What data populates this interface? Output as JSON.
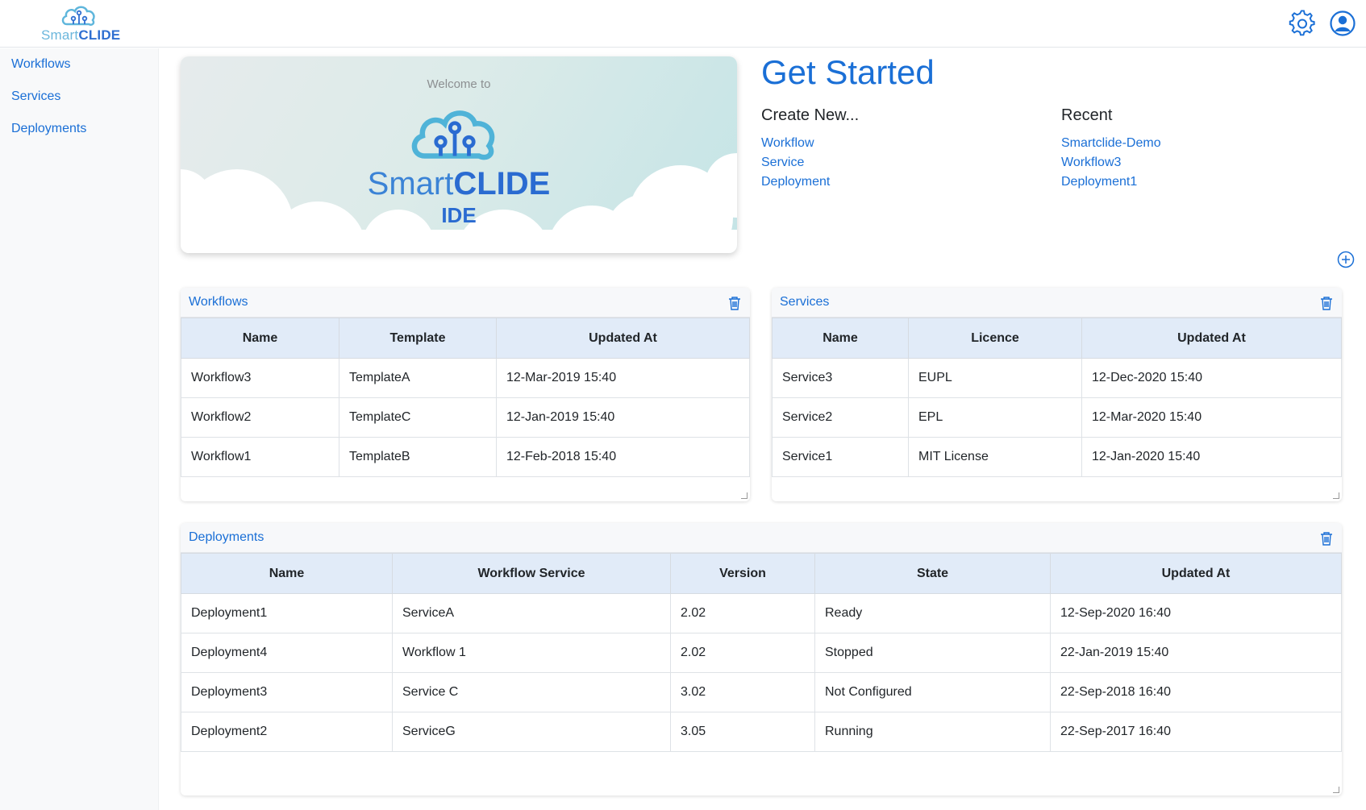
{
  "app": {
    "logo_part1": "Smart",
    "logo_part2": "CLIDE"
  },
  "header": {
    "icons": [
      "gear-icon",
      "user-icon"
    ]
  },
  "sidebar": {
    "items": [
      {
        "label": "Workflows"
      },
      {
        "label": "Services"
      },
      {
        "label": "Deployments"
      }
    ]
  },
  "welcome": {
    "intro": "Welcome to",
    "brand_part1": "Smart",
    "brand_part2": "CLIDE",
    "subtitle": "IDE"
  },
  "get_started": {
    "title": "Get Started",
    "create_heading": "Create New...",
    "create_links": [
      "Workflow",
      "Service",
      "Deployment"
    ],
    "recent_heading": "Recent",
    "recent_links": [
      "Smartclide-Demo",
      "Workflow3",
      "Deployment1"
    ]
  },
  "workflows_panel": {
    "title": "Workflows",
    "columns": [
      "Name",
      "Template",
      "Updated At"
    ],
    "rows": [
      [
        "Workflow3",
        "TemplateA",
        "12-Mar-2019 15:40"
      ],
      [
        "Workflow2",
        "TemplateC",
        "12-Jan-2019 15:40"
      ],
      [
        "Workflow1",
        "TemplateB",
        "12-Feb-2018 15:40"
      ]
    ]
  },
  "services_panel": {
    "title": "Services",
    "columns": [
      "Name",
      "Licence",
      "Updated At"
    ],
    "rows": [
      [
        "Service3",
        "EUPL",
        "12-Dec-2020 15:40"
      ],
      [
        "Service2",
        "EPL",
        "12-Mar-2020 15:40"
      ],
      [
        "Service1",
        "MIT License",
        "12-Jan-2020 15:40"
      ]
    ]
  },
  "deployments_panel": {
    "title": "Deployments",
    "columns": [
      "Name",
      "Workflow Service",
      "Version",
      "State",
      "Updated At"
    ],
    "rows": [
      [
        "Deployment1",
        "ServiceA",
        "2.02",
        "Ready",
        "12-Sep-2020 16:40"
      ],
      [
        "Deployment4",
        "Workflow 1",
        "2.02",
        "Stopped",
        "22-Jan-2019 15:40"
      ],
      [
        "Deployment3",
        "Service C",
        "3.02",
        "Not Configured",
        "22-Sep-2018 16:40"
      ],
      [
        "Deployment2",
        "ServiceG",
        "3.05",
        "Running",
        "22-Sep-2017 16:40"
      ]
    ]
  },
  "colors": {
    "accent": "#1a6fd6",
    "table_header": "#e1ebf8",
    "sidebar_bg": "#f8f9fa"
  }
}
